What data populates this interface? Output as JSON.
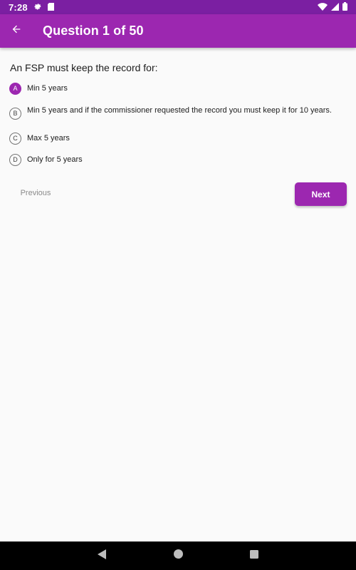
{
  "status_bar": {
    "time": "7:28",
    "icons": [
      "gear-icon",
      "sd-card-icon",
      "wifi-icon",
      "signal-icon",
      "battery-icon"
    ]
  },
  "app_bar": {
    "title": "Question 1 of 50",
    "back_icon": "arrow-back-icon",
    "color": "#9c27b0"
  },
  "question": {
    "text": "An FSP must keep the record for:",
    "options": [
      {
        "letter": "A",
        "text": "Min 5 years",
        "selected": true
      },
      {
        "letter": "B",
        "text": "Min 5 years and if the commissioner requested the record you must keep it for 10 years.",
        "selected": false
      },
      {
        "letter": "C",
        "text": "Max 5 years",
        "selected": false
      },
      {
        "letter": "D",
        "text": "Only for 5 years",
        "selected": false
      }
    ]
  },
  "buttons": {
    "previous_label": "Previous",
    "next_label": "Next"
  },
  "nav_bar": {
    "icons": [
      "back-triangle-icon",
      "home-circle-icon",
      "recents-square-icon"
    ]
  }
}
